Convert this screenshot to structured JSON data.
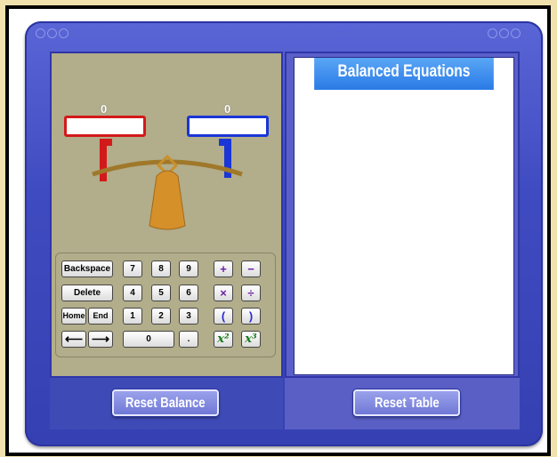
{
  "balance": {
    "left_value": "0",
    "right_value": "0"
  },
  "keypad": {
    "backspace": "Backspace",
    "delete": "Delete",
    "home": "Home",
    "end": "End",
    "left_arrow": "⟵",
    "right_arrow": "⟶",
    "digits": [
      "7",
      "8",
      "9",
      "4",
      "5",
      "6",
      "1",
      "2",
      "3",
      "0",
      "."
    ],
    "plus": "+",
    "minus": "−",
    "times": "×",
    "divide": "÷",
    "lparen": "(",
    "rparen": ")",
    "square": "x²",
    "cube": "x³"
  },
  "table": {
    "title": "Balanced Equations"
  },
  "buttons": {
    "reset_balance": "Reset Balance",
    "reset_table": "Reset Table"
  },
  "colors": {
    "background": "#f1e2ad",
    "device": "#3f4bc0",
    "left_pan": "#d31a1a",
    "right_pan": "#1a36d6",
    "table_header": "#2a7ae6"
  }
}
